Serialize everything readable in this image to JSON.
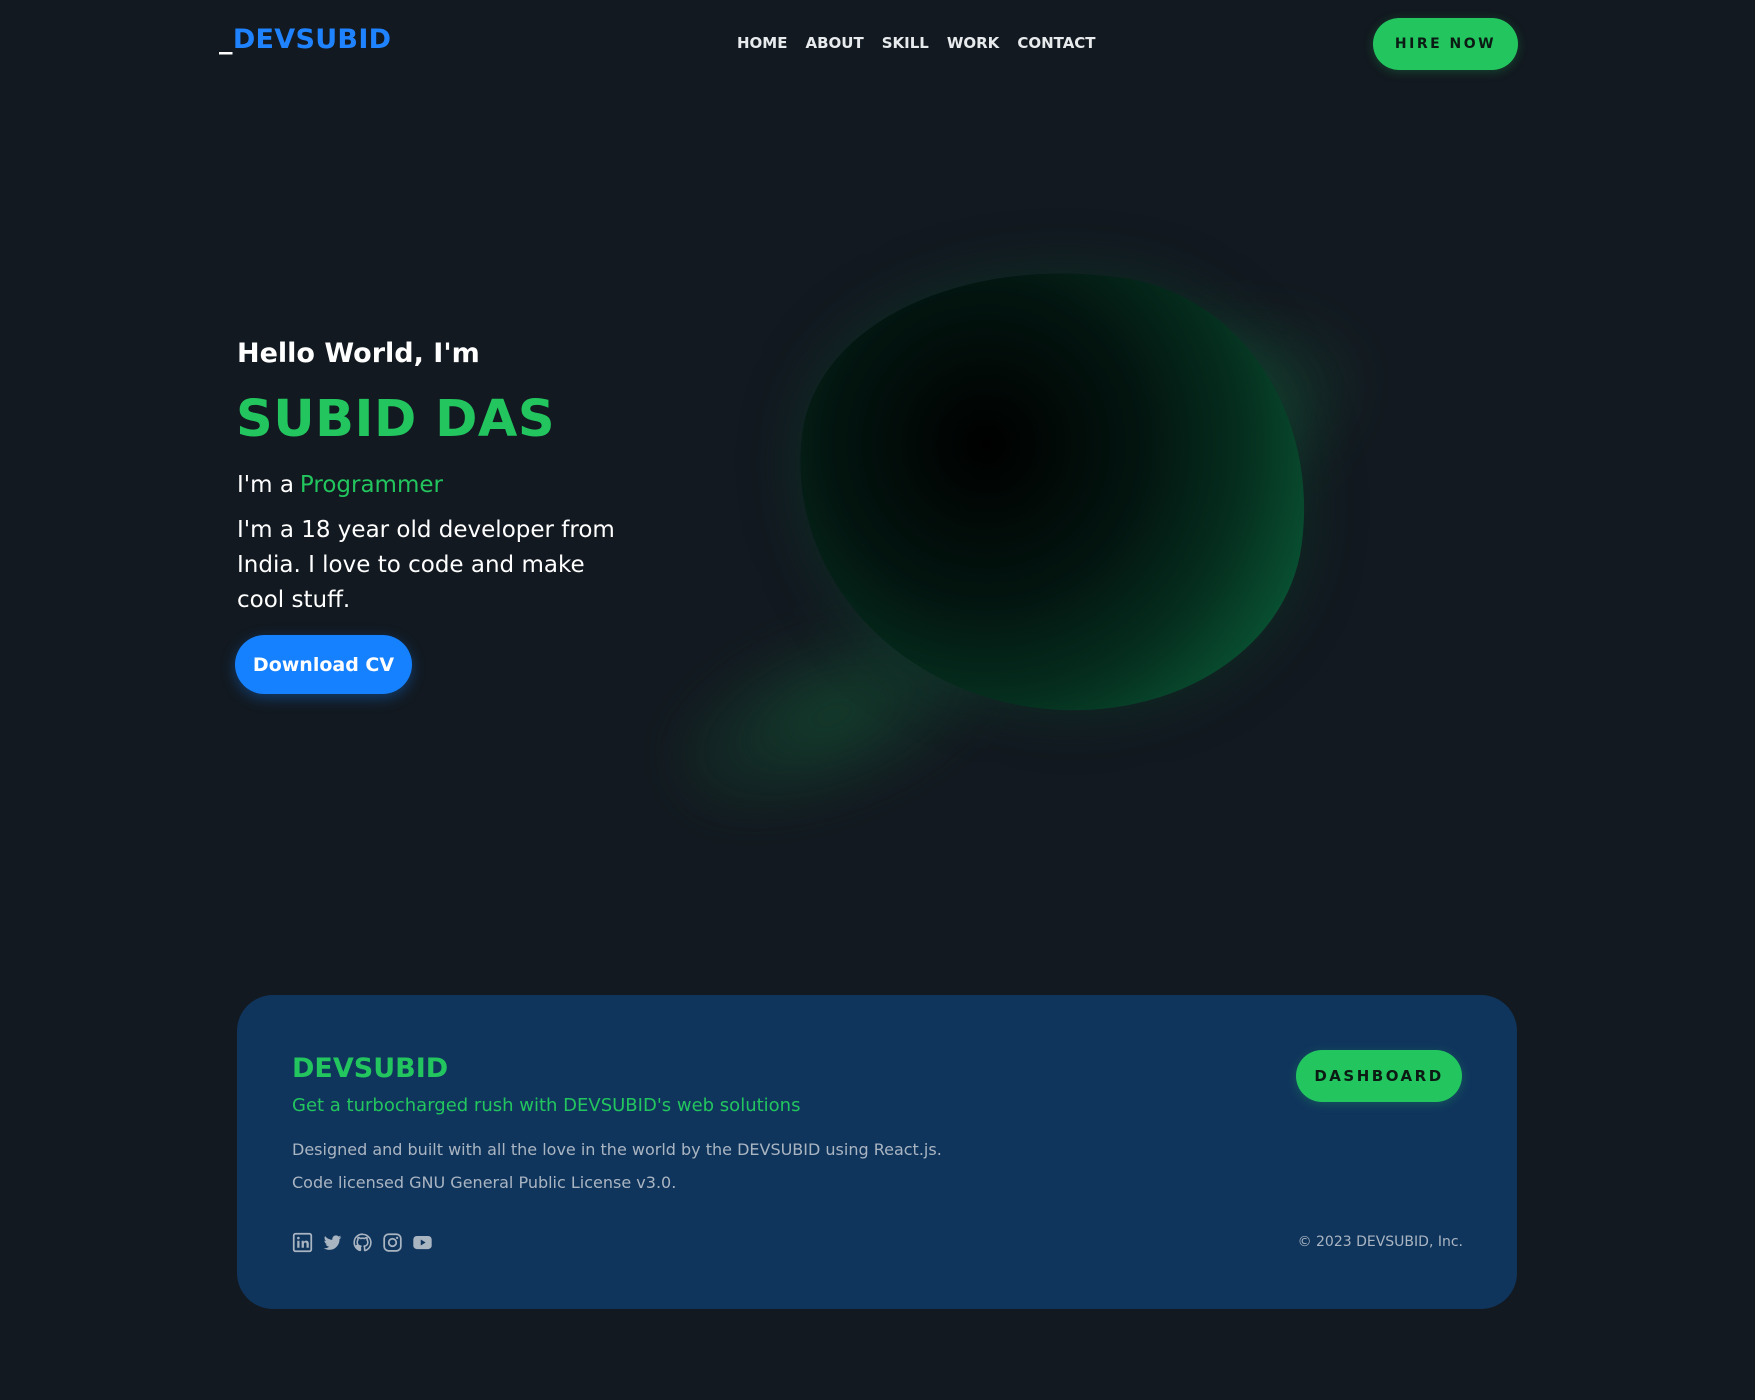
{
  "header": {
    "logo_prefix": "_",
    "logo_text": "DEVSUBID",
    "nav": [
      "HOME",
      "ABOUT",
      "SKILL",
      "WORK",
      "CONTACT"
    ],
    "hire_button": "HIRE NOW"
  },
  "hero": {
    "greeting": "Hello World, I'm",
    "name": "SUBID DAS",
    "role_prefix": "I'm a",
    "role": "Programmer",
    "bio": "I'm a 18 year old developer from India. I love to code and make cool stuff.",
    "cta": "Download CV"
  },
  "footer": {
    "brand": "DEVSUBID",
    "tagline": "Get a turbocharged rush with DEVSUBID's web solutions",
    "line1": "Designed and built with all the love in the world by the DEVSUBID using React.js.",
    "line2": "Code licensed GNU General Public License v3.0.",
    "dashboard_button": "DASHBOARD",
    "copyright": "© 2023 DEVSUBID, Inc.",
    "social_icons": [
      "linkedin-icon",
      "twitter-icon",
      "github-icon",
      "instagram-icon",
      "youtube-icon"
    ]
  },
  "colors": {
    "background": "#121920",
    "accent_green": "#22c55e",
    "accent_blue": "#1581ff",
    "footer_card": "#10355d",
    "muted_text": "#aab5c2"
  }
}
